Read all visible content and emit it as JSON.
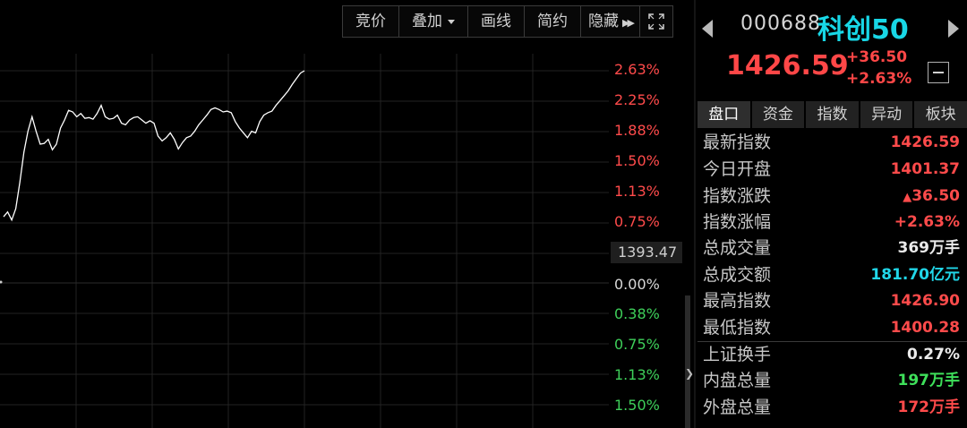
{
  "toolbar": {
    "auction": "竞价",
    "overlay": "叠加",
    "draw": "画线",
    "simple": "简约",
    "hide": "隐藏"
  },
  "axis_labels": {
    "up": [
      "2.63%",
      "2.25%",
      "1.88%",
      "1.50%",
      "1.13%",
      "0.75%"
    ],
    "zero": "0.00%",
    "down": [
      "0.38%",
      "0.75%",
      "1.13%",
      "1.50%"
    ]
  },
  "price_tag": "1393.47",
  "quote": {
    "code": "000688",
    "name": "科创50",
    "price": "1426.59",
    "change": "+36.50",
    "change_pct": "+2.63%"
  },
  "tabs": [
    "盘口",
    "资金",
    "指数",
    "异动",
    "板块"
  ],
  "stats": [
    {
      "label": "最新指数",
      "value": "1426.59",
      "color": "red"
    },
    {
      "label": "今日开盘",
      "value": "1401.37",
      "color": "red"
    },
    {
      "label": "指数涨跌",
      "value": "36.50",
      "prefix": "▲",
      "color": "red"
    },
    {
      "label": "指数涨幅",
      "value": "+2.63%",
      "color": "red"
    },
    {
      "label": "总成交量",
      "value": "369",
      "unit": "万手",
      "color": "white"
    },
    {
      "label": "总成交额",
      "value": "181.70",
      "unit": "亿元",
      "color": "cyan"
    },
    {
      "label": "最高指数",
      "value": "1426.90",
      "color": "red"
    },
    {
      "label": "最低指数",
      "value": "1400.28",
      "color": "red"
    },
    {
      "label": "上证换手",
      "value": "0.27%",
      "color": "white"
    },
    {
      "label": "内盘总量",
      "value": "197",
      "unit": "万手",
      "color": "green"
    },
    {
      "label": "外盘总量",
      "value": "172",
      "unit": "万手",
      "color": "red"
    }
  ],
  "colors": {
    "up": "#ff4b4b",
    "down": "#3ecf5a",
    "accent": "#18d7e6",
    "line": "#ffffff",
    "grid": "#222222"
  },
  "chart_data": {
    "type": "line",
    "y_unit": "%",
    "ylim": [
      -1.5,
      2.63
    ],
    "grid": true,
    "series": [
      {
        "values": [
          0.82,
          0.88,
          0.78,
          0.92,
          1.25,
          1.62,
          1.88,
          2.06,
          1.88,
          1.72,
          1.73,
          1.78,
          1.65,
          1.72,
          1.92,
          2.02,
          2.14,
          2.12,
          2.06,
          2.1,
          2.04,
          2.05,
          2.03,
          2.1,
          2.2,
          2.06,
          2.03,
          2.04,
          2.08,
          1.98,
          1.96,
          2.02,
          2.05,
          2.06,
          2.02,
          1.98,
          2.01,
          1.98,
          1.82,
          1.76,
          1.8,
          1.86,
          1.78,
          1.66,
          1.74,
          1.8,
          1.82,
          1.88,
          1.96,
          2.02,
          2.08,
          2.15,
          2.17,
          2.15,
          2.12,
          2.13,
          2.11,
          2.0,
          1.92,
          1.86,
          1.8,
          1.88,
          1.86,
          2.0,
          2.08,
          2.11,
          2.13,
          2.2,
          2.26,
          2.32,
          2.38,
          2.46,
          2.53,
          2.6,
          2.63
        ]
      }
    ]
  }
}
